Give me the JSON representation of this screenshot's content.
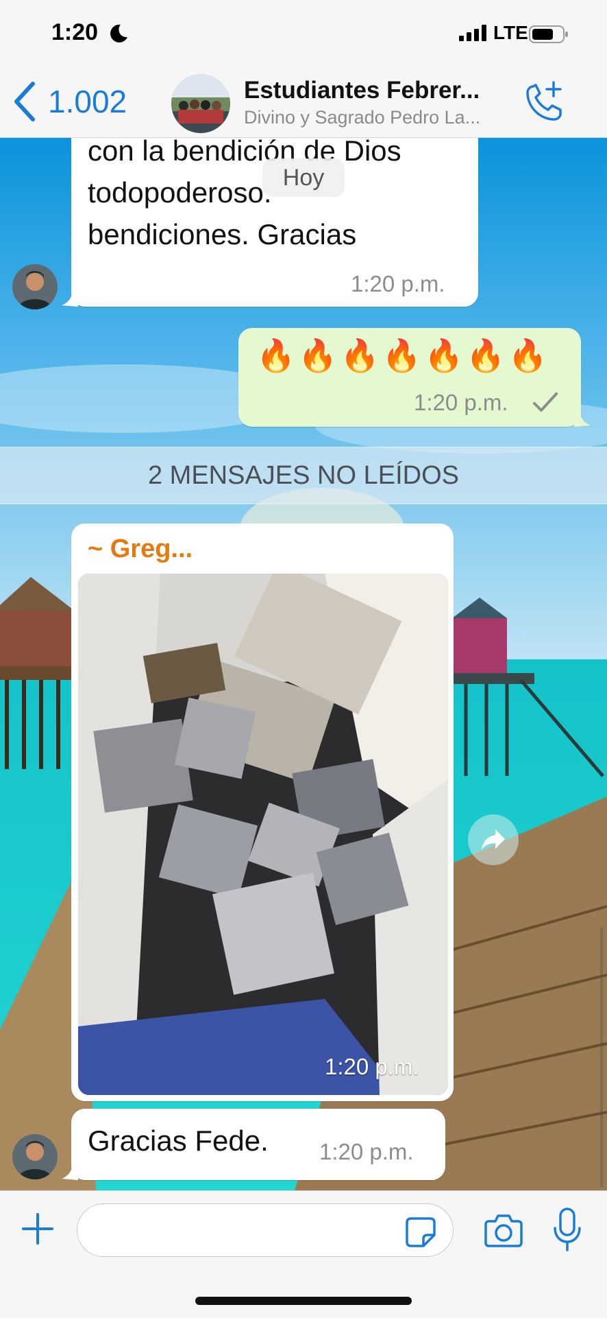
{
  "status_bar": {
    "time": "1:20",
    "network": "LTE"
  },
  "header": {
    "back_count": "1.002",
    "title": "Estudiantes Febrer...",
    "subtitle": "Divino y Sagrado Pedro La..."
  },
  "chat": {
    "date_pill": "Hoy",
    "msg1": {
      "lines": [
        "con la bendición de Dios",
        "todopoderoso.",
        "bendiciones. Gracias"
      ],
      "time": "1:20 p.m."
    },
    "msg2": {
      "text": "🔥🔥🔥🔥🔥🔥🔥",
      "time": "1:20 p.m.",
      "status": "sent"
    },
    "unread_label": "2 MENSAJES NO LEÍDOS",
    "msg3": {
      "sender": "~ Greg...",
      "time": "1:20 p.m."
    },
    "msg4": {
      "text": "Gracias Fede.",
      "time": "1:20 p.m."
    }
  },
  "colors": {
    "accent": "#1a7cd6",
    "sender_name": "#e37a12",
    "outgoing_bubble": "#e5f9d0"
  },
  "icons": [
    "moon-icon",
    "signal-icon",
    "battery-icon",
    "back-chevron-icon",
    "add-call-icon",
    "forward-icon",
    "plus-icon",
    "sticker-icon",
    "camera-icon",
    "microphone-icon"
  ]
}
